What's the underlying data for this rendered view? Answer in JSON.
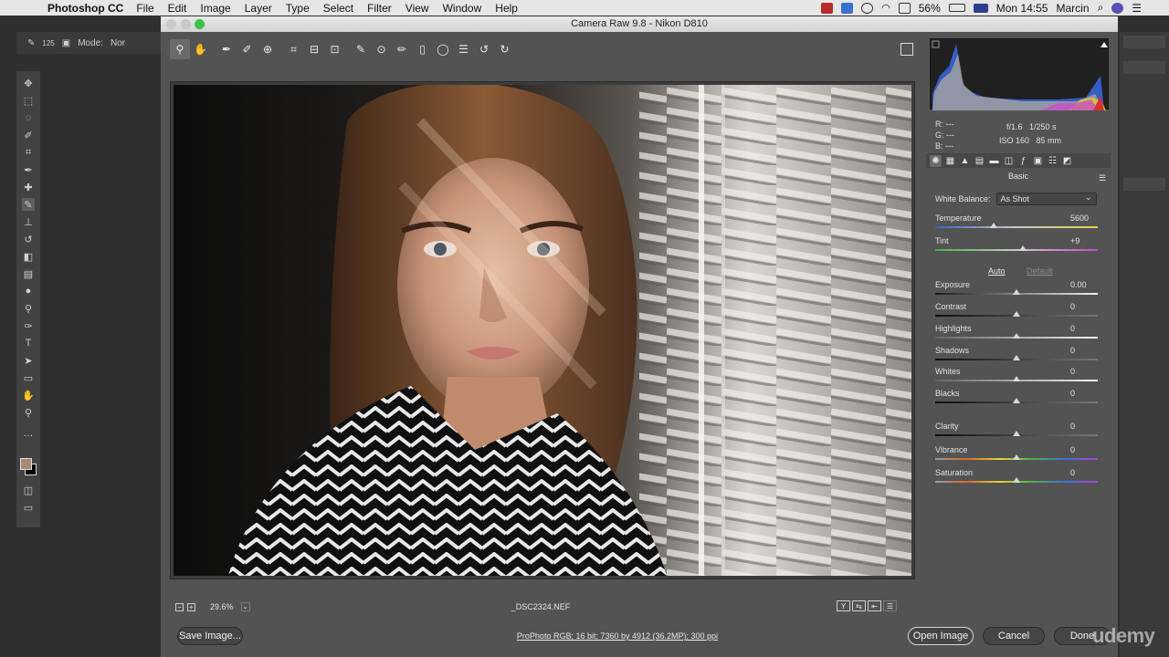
{
  "menubar": {
    "app_name": "Photoshop CC",
    "items": [
      "File",
      "Edit",
      "Image",
      "Layer",
      "Type",
      "Select",
      "Filter",
      "View",
      "Window",
      "Help"
    ],
    "battery": "56%",
    "clock": "Mon 14:55",
    "user": "Marcin"
  },
  "ps_options": {
    "brush_size": "125",
    "mode_label": "Mode:",
    "mode_value": "Nor"
  },
  "camera_raw": {
    "title": "Camera Raw 9.8  -  Nikon D810",
    "readout": {
      "r": "R:  ---",
      "g": "G:  ---",
      "b": "B:  ---",
      "aperture": "f/1.6",
      "shutter": "1/250 s",
      "iso": "ISO 160",
      "focal": "85 mm"
    },
    "panel_title": "Basic",
    "white_balance": {
      "label": "White Balance:",
      "value": "As Shot"
    },
    "auto_label": "Auto",
    "default_label": "Default",
    "adjustments": [
      {
        "label": "Temperature",
        "value": "5600",
        "position": 0.36,
        "track": "temp"
      },
      {
        "label": "Tint",
        "value": "+9",
        "position": 0.54,
        "track": "tint"
      },
      {
        "label": "Exposure",
        "value": "0.00",
        "position": 0.5,
        "track": "exp"
      },
      {
        "label": "Contrast",
        "value": "0",
        "position": 0.5,
        "track": "dark"
      },
      {
        "label": "Highlights",
        "value": "0",
        "position": 0.5,
        "track": "light"
      },
      {
        "label": "Shadows",
        "value": "0",
        "position": 0.5,
        "track": "dark"
      },
      {
        "label": "Whites",
        "value": "0",
        "position": 0.5,
        "track": "light"
      },
      {
        "label": "Blacks",
        "value": "0",
        "position": 0.5,
        "track": "dark"
      },
      {
        "label": "Clarity",
        "value": "0",
        "position": 0.5,
        "track": "dark"
      },
      {
        "label": "Vibrance",
        "value": "0",
        "position": 0.5,
        "track": "sat"
      },
      {
        "label": "Saturation",
        "value": "0",
        "position": 0.5,
        "track": "sat"
      }
    ],
    "zoom": "29.6%",
    "filename": "_DSC2324.NEF",
    "workflow": "ProPhoto RGB; 16 bit; 7360 by 4912 (36.2MP); 300 ppi",
    "buttons": {
      "save": "Save Image...",
      "open": "Open Image",
      "cancel": "Cancel",
      "done": "Done"
    }
  },
  "watermark": "udemy"
}
